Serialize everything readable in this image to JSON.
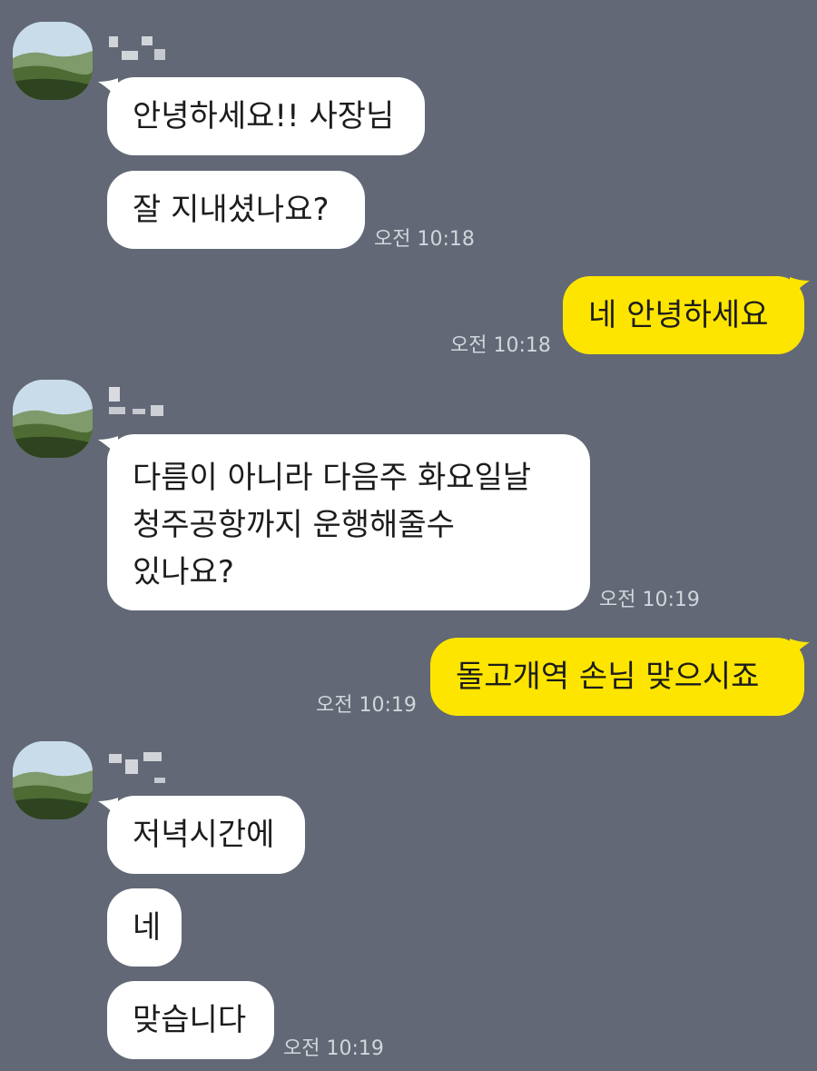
{
  "colors": {
    "background": "#626875",
    "incoming_bubble": "#ffffff",
    "outgoing_bubble": "#fee500",
    "timestamp": "#d2d5da"
  },
  "messages": [
    {
      "text": "안녕하세요!! 사장님"
    },
    {
      "text": "잘 지내셨나요?",
      "time": "오전 10:18"
    },
    {
      "text": "네 안녕하세요",
      "time": "오전 10:18"
    },
    {
      "lines": [
        "다름이 아니라 다음주 화요일날",
        "청주공항까지 운행해줄수",
        "있나요?"
      ],
      "time": "오전 10:19"
    },
    {
      "text": "돌고개역 손님 맞으시죠",
      "time": "오전 10:19"
    },
    {
      "text": "저녁시간에"
    },
    {
      "text": "네"
    },
    {
      "text": "맞습니다",
      "time": "오전 10:19"
    }
  ]
}
